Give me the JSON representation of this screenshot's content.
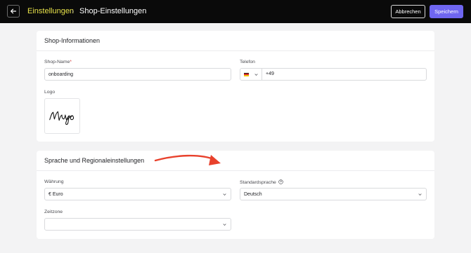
{
  "header": {
    "breadcrumb_parent": "Einstellungen",
    "breadcrumb_separator": "›",
    "breadcrumb_current": "Shop-Einstellungen",
    "cancel_label": "Abbrechen",
    "save_label": "Speichern",
    "back_icon": "arrow-left-icon"
  },
  "shop_info": {
    "title": "Shop-Informationen",
    "shop_name_label": "Shop-Name",
    "shop_name_required": "*",
    "shop_name_value": "onboarding",
    "phone_label": "Telefon",
    "phone_country": "DE",
    "phone_prefix": "+49",
    "logo_label": "Logo",
    "logo_text": "Mugo"
  },
  "regional": {
    "title": "Sprache und Regionaleinstellungen",
    "currency_label": "Währung",
    "currency_value": "€ Euro",
    "language_label": "Standardsprache",
    "language_value": "Deutsch",
    "timezone_label": "Zeitzone",
    "timezone_value": ""
  },
  "colors": {
    "topbar": "#0a0a0a",
    "breadcrumb_parent": "#e8e24a",
    "save_button": "#6f66f0",
    "annotation_arrow": "#e8412c"
  }
}
